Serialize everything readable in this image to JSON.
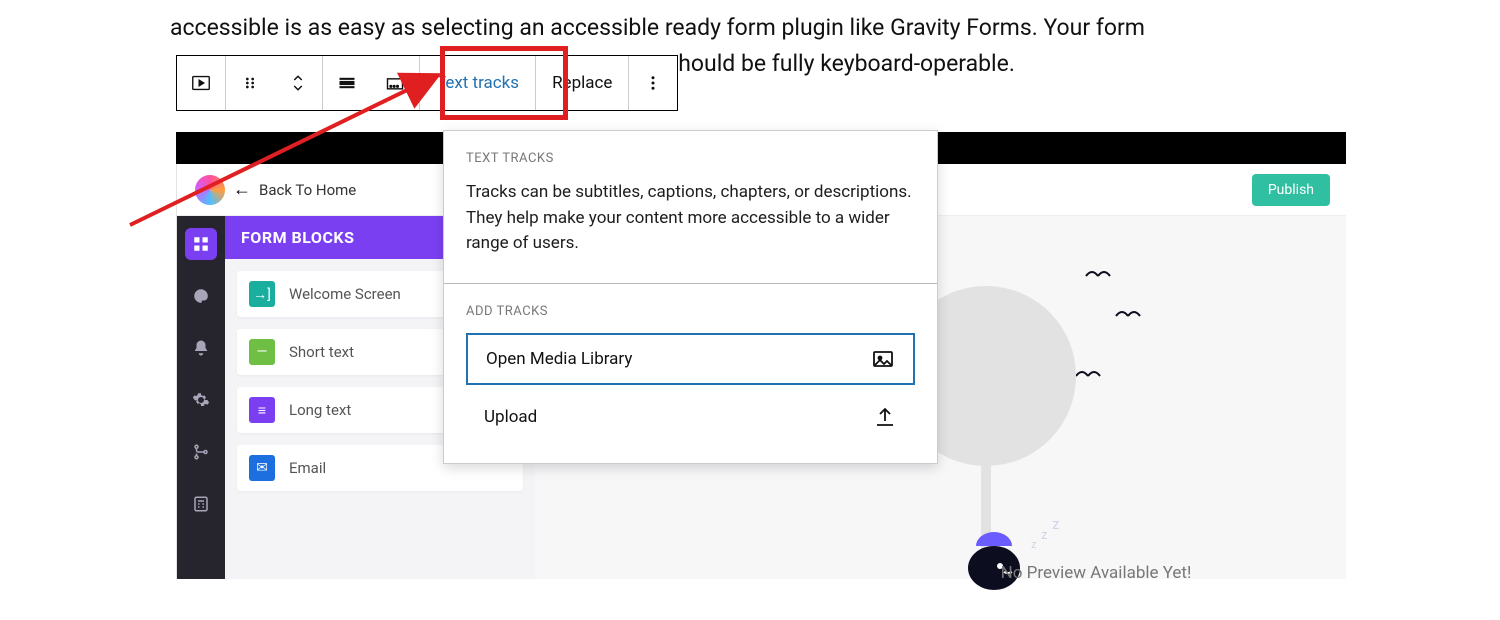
{
  "article": {
    "line1": "accessible is as easy as selecting an accessible ready form plugin like Gravity Forms. Your form",
    "line2_tail": " should be fully keyboard-operable."
  },
  "toolbar": {
    "text_tracks": "Text tracks",
    "replace": "Replace"
  },
  "popover": {
    "heading1": "TEXT TRACKS",
    "desc": "Tracks can be subtitles, captions, chapters, or descriptions. They help make your content more accessible to a wider range of users.",
    "heading2": "ADD TRACKS",
    "open_media": "Open Media Library",
    "upload": "Upload"
  },
  "app": {
    "back": "Back To Home",
    "publish": "Publish",
    "panel_title": "FORM BLOCKS",
    "blocks": [
      {
        "label": "Welcome Screen",
        "color": "c-teal",
        "icon": "→]"
      },
      {
        "label": "Short text",
        "color": "c-green",
        "icon": "—"
      },
      {
        "label": "Long text",
        "color": "c-purple",
        "icon": "≡"
      },
      {
        "label": "Email",
        "color": "c-blue",
        "icon": "✉"
      }
    ],
    "preview_empty": "No Preview Available Yet!"
  }
}
